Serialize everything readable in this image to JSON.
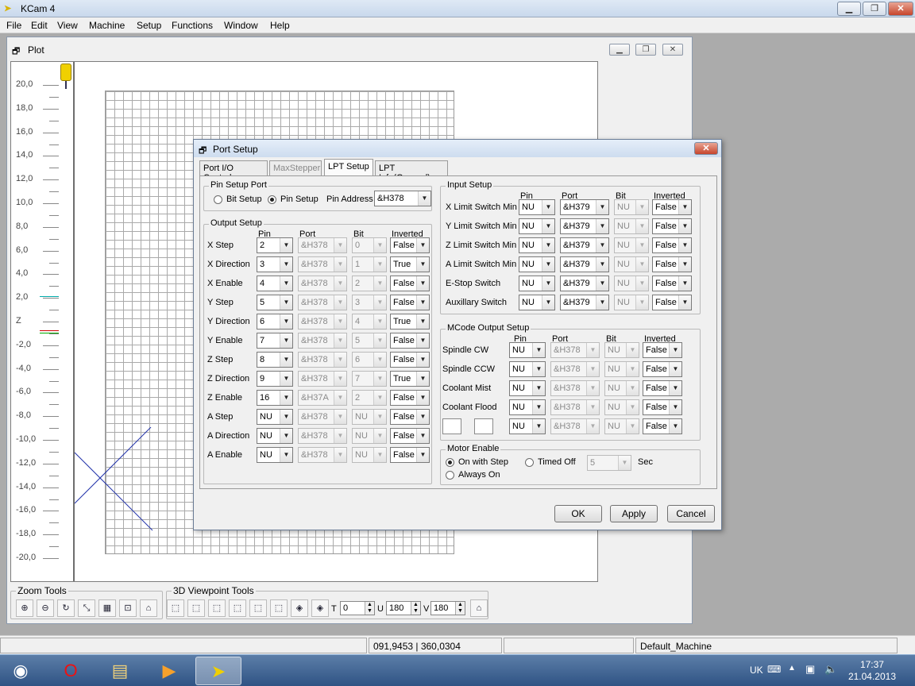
{
  "app": {
    "title": "KCam 4"
  },
  "menu": [
    "File",
    "Edit",
    "View",
    "Machine",
    "Setup",
    "Functions",
    "Window",
    "Help"
  ],
  "plot": {
    "title": "Plot",
    "ruler": [
      "20,0",
      "18,0",
      "16,0",
      "14,0",
      "12,0",
      "10,0",
      "8,0",
      "6,0",
      "4,0",
      "2,0",
      "Z",
      "-2,0",
      "-4,0",
      "-6,0",
      "-8,0",
      "-10,0",
      "-12,0",
      "-14,0",
      "-16,0",
      "-18,0",
      "-20,0"
    ]
  },
  "zoom_tools": {
    "label": "Zoom Tools"
  },
  "viewpoint_tools": {
    "label": "3D Viewpoint Tools",
    "t_label": "T",
    "t_value": "0",
    "u_label": "U",
    "u_value": "180",
    "v_label": "V",
    "v_value": "180"
  },
  "dialog": {
    "title": "Port Setup",
    "tabs": [
      "Port I/O Controls",
      "MaxStepper",
      "LPT Setup",
      "LPT Info(General)"
    ],
    "pin_setup_port": {
      "label": "Pin Setup Port",
      "bit_setup": "Bit Setup",
      "pin_setup": "Pin Setup",
      "pin_address_label": "Pin Address",
      "pin_address": "&H378"
    },
    "output_setup": {
      "label": "Output Setup",
      "headers": [
        "Pin",
        "Port",
        "Bit",
        "Inverted"
      ],
      "rows": [
        {
          "name": "X Step",
          "pin": "2",
          "port": "&H378",
          "bit": "0",
          "inv": "False"
        },
        {
          "name": "X Direction",
          "pin": "3",
          "port": "&H378",
          "bit": "1",
          "inv": "True"
        },
        {
          "name": "X Enable",
          "pin": "4",
          "port": "&H378",
          "bit": "2",
          "inv": "False"
        },
        {
          "name": "Y Step",
          "pin": "5",
          "port": "&H378",
          "bit": "3",
          "inv": "False"
        },
        {
          "name": "Y Direction",
          "pin": "6",
          "port": "&H378",
          "bit": "4",
          "inv": "True"
        },
        {
          "name": "Y Enable",
          "pin": "7",
          "port": "&H378",
          "bit": "5",
          "inv": "False"
        },
        {
          "name": "Z Step",
          "pin": "8",
          "port": "&H378",
          "bit": "6",
          "inv": "False"
        },
        {
          "name": "Z Direction",
          "pin": "9",
          "port": "&H378",
          "bit": "7",
          "inv": "True"
        },
        {
          "name": "Z Enable",
          "pin": "16",
          "port": "&H37A",
          "bit": "2",
          "inv": "False"
        },
        {
          "name": "A Step",
          "pin": "NU",
          "port": "&H378",
          "bit": "NU",
          "inv": "False"
        },
        {
          "name": "A Direction",
          "pin": "NU",
          "port": "&H378",
          "bit": "NU",
          "inv": "False"
        },
        {
          "name": "A Enable",
          "pin": "NU",
          "port": "&H378",
          "bit": "NU",
          "inv": "False"
        }
      ]
    },
    "input_setup": {
      "label": "Input Setup",
      "headers": [
        "Pin",
        "Port",
        "Bit",
        "Inverted"
      ],
      "rows": [
        {
          "name": "X Limit Switch Min",
          "pin": "NU",
          "port": "&H379",
          "bit": "NU",
          "inv": "False"
        },
        {
          "name": "Y Limit Switch Min",
          "pin": "NU",
          "port": "&H379",
          "bit": "NU",
          "inv": "False"
        },
        {
          "name": "Z Limit Switch Min",
          "pin": "NU",
          "port": "&H379",
          "bit": "NU",
          "inv": "False"
        },
        {
          "name": "A Limit Switch Min",
          "pin": "NU",
          "port": "&H379",
          "bit": "NU",
          "inv": "False"
        },
        {
          "name": "E-Stop Switch",
          "pin": "NU",
          "port": "&H379",
          "bit": "NU",
          "inv": "False"
        },
        {
          "name": "Auxillary Switch",
          "pin": "NU",
          "port": "&H379",
          "bit": "NU",
          "inv": "False"
        }
      ]
    },
    "mcode_setup": {
      "label": "MCode Output Setup",
      "headers": [
        "Pin",
        "Port",
        "Bit",
        "Inverted"
      ],
      "rows": [
        {
          "name": "Spindle CW",
          "pin": "NU",
          "port": "&H378",
          "bit": "NU",
          "inv": "False"
        },
        {
          "name": "Spindle CCW",
          "pin": "NU",
          "port": "&H378",
          "bit": "NU",
          "inv": "False"
        },
        {
          "name": "Coolant Mist",
          "pin": "NU",
          "port": "&H378",
          "bit": "NU",
          "inv": "False"
        },
        {
          "name": "Coolant Flood",
          "pin": "NU",
          "port": "&H378",
          "bit": "NU",
          "inv": "False"
        },
        {
          "name": "",
          "pin": "NU",
          "port": "&H378",
          "bit": "NU",
          "inv": "False"
        }
      ]
    },
    "motor_enable": {
      "label": "Motor Enable",
      "on_with_step": "On with Step",
      "timed_off": "Timed Off",
      "timed_value": "5",
      "sec": "Sec",
      "always_on": "Always On"
    },
    "buttons": {
      "ok": "OK",
      "apply": "Apply",
      "cancel": "Cancel"
    }
  },
  "status": {
    "coords": "091,9453 | 360,0304",
    "machine": "Default_Machine"
  },
  "taskbar": {
    "lang": "UK",
    "time": "17:37",
    "date": "21.04.2013"
  }
}
